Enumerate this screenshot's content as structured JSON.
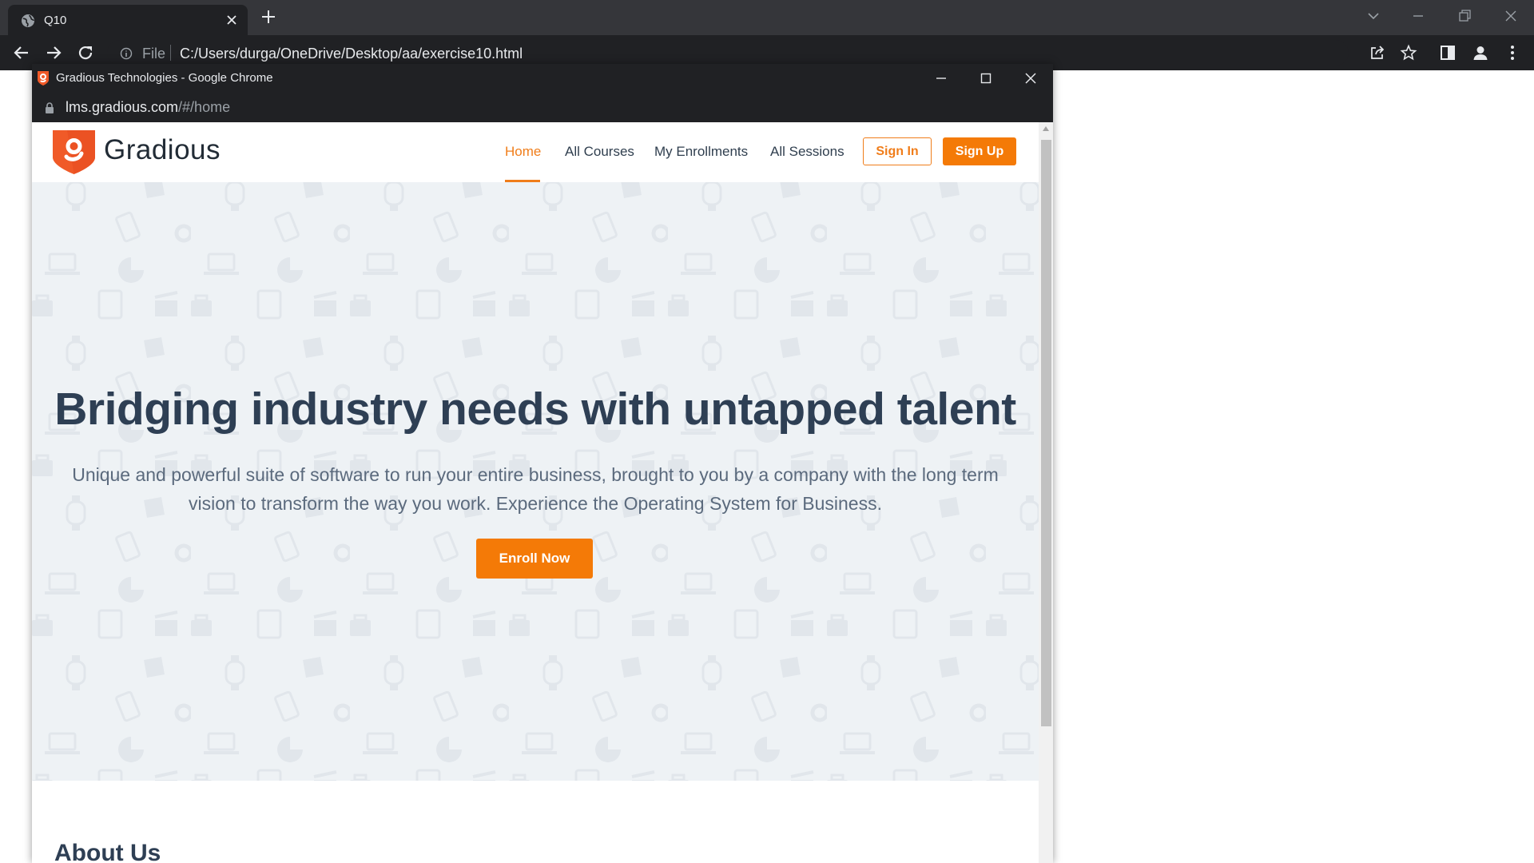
{
  "browser": {
    "tab_title": "Q10",
    "omnibox_file_label": "File",
    "omnibox_url": "C:/Users/durga/OneDrive/Desktop/aa/exercise10.html"
  },
  "popup": {
    "window_title": "Gradious Technologies - Google Chrome",
    "url_host": "lms.gradious.com",
    "url_path": "/#/home"
  },
  "site": {
    "brand_name": "Gradious",
    "brand_color": "#f07d1a",
    "nav": [
      {
        "label": "Home",
        "active": true
      },
      {
        "label": "All Courses",
        "active": false
      },
      {
        "label": "My Enrollments",
        "active": false
      },
      {
        "label": "All Sessions",
        "active": false
      }
    ],
    "signin_label": "Sign In",
    "signup_label": "Sign Up",
    "hero": {
      "title": "Bridging industry needs with untapped talent",
      "subtitle_line1": "Unique and powerful suite of software to run your entire business, brought to you by a company with the long term",
      "subtitle_line2": "vision to transform the way you work. Experience the Operating System for Business.",
      "cta_label": "Enroll Now"
    },
    "next_section_heading_partial": "About Us"
  }
}
